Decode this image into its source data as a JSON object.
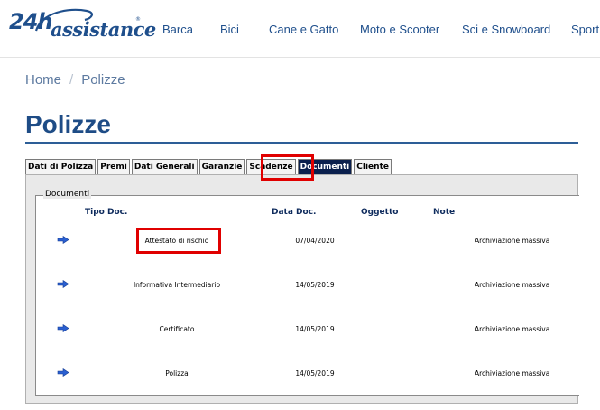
{
  "brand": {
    "logo_number": "24h",
    "logo_text": "assistance",
    "logo_mark": "®"
  },
  "nav": {
    "items": [
      {
        "label": "Barca"
      },
      {
        "label": "Bici"
      },
      {
        "label": "Cane e Gatto"
      },
      {
        "label": "Moto e Scooter"
      },
      {
        "label": "Sci e Snowboard"
      },
      {
        "label": "Sport"
      }
    ]
  },
  "breadcrumb": {
    "home": "Home",
    "separator": "/",
    "current": "Polizze"
  },
  "page": {
    "title": "Polizze"
  },
  "tabs": [
    {
      "label": "Dati di Polizza",
      "active": false
    },
    {
      "label": "Premi",
      "active": false
    },
    {
      "label": "Dati Generali",
      "active": false
    },
    {
      "label": "Garanzie",
      "active": false
    },
    {
      "label": "Scadenze",
      "active": false
    },
    {
      "label": "Documenti",
      "active": true
    },
    {
      "label": "Cliente",
      "active": false
    }
  ],
  "documents": {
    "legend": "Documenti",
    "columns": {
      "tipo": "Tipo Doc.",
      "data": "Data Doc.",
      "oggetto": "Oggetto",
      "note": "Note"
    },
    "rows": [
      {
        "tipo": "Attestato di rischio",
        "data": "07/04/2020",
        "oggetto": "",
        "note": "Archiviazione massiva"
      },
      {
        "tipo": "Informativa Intermediario",
        "data": "14/05/2019",
        "oggetto": "",
        "note": "Archiviazione massiva"
      },
      {
        "tipo": "Certificato",
        "data": "14/05/2019",
        "oggetto": "",
        "note": "Archiviazione massiva"
      },
      {
        "tipo": "Polizza",
        "data": "14/05/2019",
        "oggetto": "",
        "note": "Archiviazione massiva"
      }
    ]
  },
  "colors": {
    "brand_blue": "#1f4f8c",
    "active_tab": "#0a1f4d",
    "highlight": "#e00000",
    "arrow": "#2a5fd0"
  },
  "icons": {
    "row_open": "arrow-right-icon"
  }
}
